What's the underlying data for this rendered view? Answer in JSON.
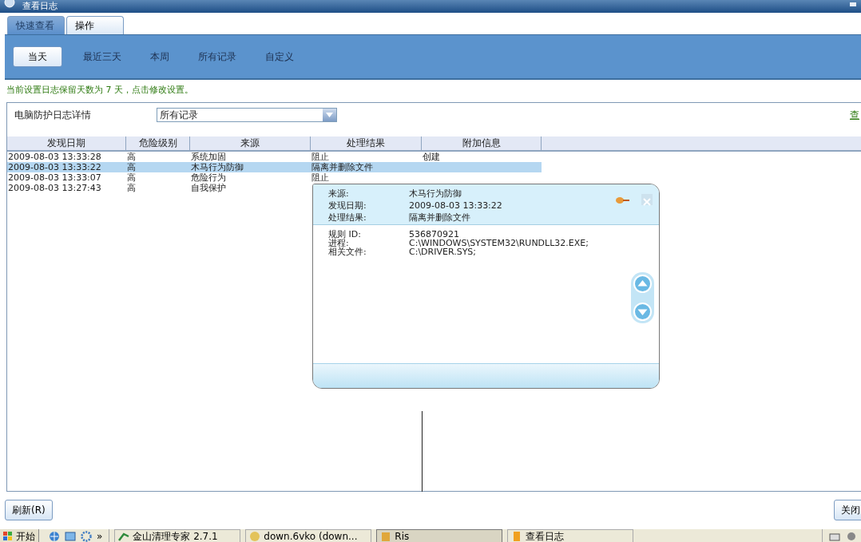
{
  "window": {
    "title": "查看日志"
  },
  "tabs": [
    {
      "label": "快速查看",
      "selected": true
    },
    {
      "label": "操作",
      "selected": false
    }
  ],
  "filters": [
    {
      "label": "当天",
      "selected": true
    },
    {
      "label": "最近三天",
      "selected": false
    },
    {
      "label": "本周",
      "selected": false
    },
    {
      "label": "所有记录",
      "selected": false
    },
    {
      "label": "自定义",
      "selected": false
    }
  ],
  "notice": "当前设置日志保留天数为 7 天，点击修改设置。",
  "panel": {
    "label": "电脑防护日志详情",
    "dropdown": {
      "value": "所有记录"
    },
    "link": "查"
  },
  "table": {
    "columns": [
      "发现日期",
      "危险级别",
      "来源",
      "处理结果",
      "附加信息"
    ],
    "rows": [
      {
        "date": "2009-08-03 13:33:28",
        "level": "高",
        "source": "系统加固",
        "result": "阻止",
        "info": "创建",
        "selected": false
      },
      {
        "date": "2009-08-03 13:33:22",
        "level": "高",
        "source": "木马行为防御",
        "result": "隔离并删除文件",
        "selected": true
      },
      {
        "date": "2009-08-03 13:33:07",
        "level": "高",
        "source": "危险行为",
        "result": "阻止",
        "selected": false
      },
      {
        "date": "2009-08-03 13:27:43",
        "level": "高",
        "source": "自我保护",
        "selected": false
      }
    ]
  },
  "popup": {
    "summary": [
      {
        "label": "来源:",
        "value": "木马行为防御"
      },
      {
        "label": "发现日期:",
        "value": "2009-08-03 13:33:22"
      },
      {
        "label": "处理结果:",
        "value": "隔离并删除文件"
      }
    ],
    "details": [
      {
        "label": "规则 ID:",
        "value": "536870921"
      },
      {
        "label": "进程:",
        "value": "C:\\WINDOWS\\SYSTEM32\\RUNDLL32.EXE;"
      },
      {
        "label": "相关文件:",
        "value": "C:\\DRIVER.SYS;"
      }
    ]
  },
  "buttons": {
    "refresh": "刷新(R)",
    "close": "关闭"
  },
  "taskbar": {
    "start": "开始",
    "quick_launch_more": "»",
    "items": [
      {
        "label": "金山清理专家 2.7.1",
        "selected": false
      },
      {
        "label": "down.6vko (down...",
        "selected": false
      },
      {
        "label": "Ris",
        "selected": true
      },
      {
        "label": "查看日志",
        "selected": false
      }
    ]
  }
}
